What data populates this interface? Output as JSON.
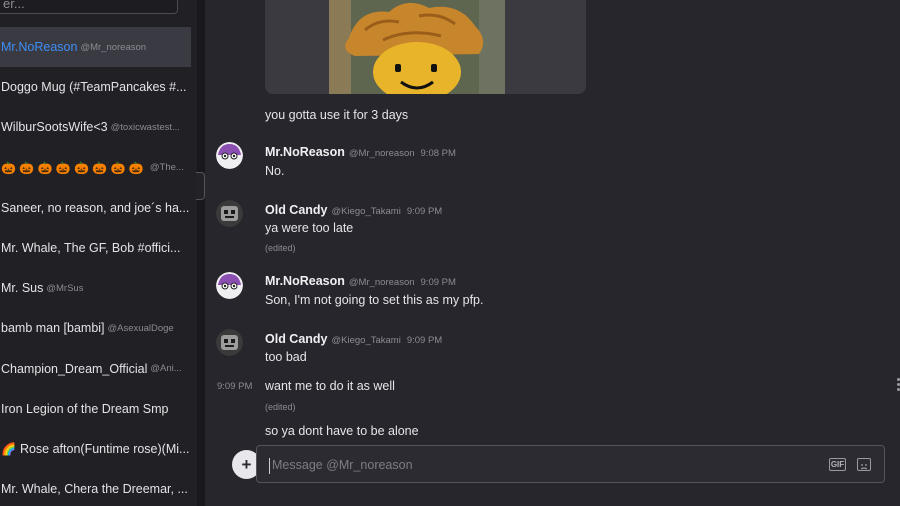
{
  "sidebar": {
    "search_placeholder": "er...",
    "dms": [
      {
        "name": "Mr.NoReason",
        "handle": "@Mr_noreason",
        "active": true
      },
      {
        "name": "Doggo Mug (#TeamPancakes #...",
        "handle": ""
      },
      {
        "name": "WilburSootsWife<3",
        "handle": "@toxicwastest..."
      },
      {
        "name": "",
        "handle": "@The...",
        "prefix": "🎃 🎃 🎃 🎃 🎃 🎃 🎃 🎃"
      },
      {
        "name": "Saneer, no reason, and joe´s ha...",
        "handle": ""
      },
      {
        "name": "Mr. Whale, The GF, Bob #offici...",
        "handle": ""
      },
      {
        "name": "Mr. Sus",
        "handle": "@MrSus"
      },
      {
        "name": "bamb man [bambi]",
        "handle": "@AsexualDoge"
      },
      {
        "name": "Champion_Dream_Official",
        "handle": "@Ani..."
      },
      {
        "name": "Iron Legion of the Dream Smp",
        "handle": ""
      },
      {
        "name": "Rose afton(Funtime rose)(Mi...",
        "handle": "",
        "prefix": "🌈"
      },
      {
        "name": "Mr. Whale, Chera the Dreemar, ...",
        "handle": ""
      }
    ]
  },
  "chat": {
    "messages": [
      {
        "text": "you gotta use it for 3 days"
      },
      {
        "author": "Mr.NoReason",
        "handle": "@Mr_noreason",
        "time": "9:08 PM",
        "text": "No."
      },
      {
        "author": "Old Candy",
        "handle": "@Kiego_Takami",
        "time": "9:09 PM",
        "text": "ya were too late",
        "edited": "(edited)"
      },
      {
        "author": "Mr.NoReason",
        "handle": "@Mr_noreason",
        "time": "9:09 PM",
        "text": "Son, I'm not going to set this as my pfp."
      },
      {
        "author": "Old Candy",
        "handle": "@Kiego_Takami",
        "time": "9:09 PM",
        "text": "too bad"
      },
      {
        "side_time": "9:09 PM",
        "text": "want me to do it as well",
        "edited": "(edited)"
      },
      {
        "text": "so ya dont have to be alone"
      }
    ],
    "compose_placeholder": "Message @Mr_noreason",
    "gif_label": "GIF",
    "plus_label": "+"
  },
  "colors": {
    "accent": "#3d8ef5",
    "background": "#26262c",
    "sidebar": "#202025"
  }
}
